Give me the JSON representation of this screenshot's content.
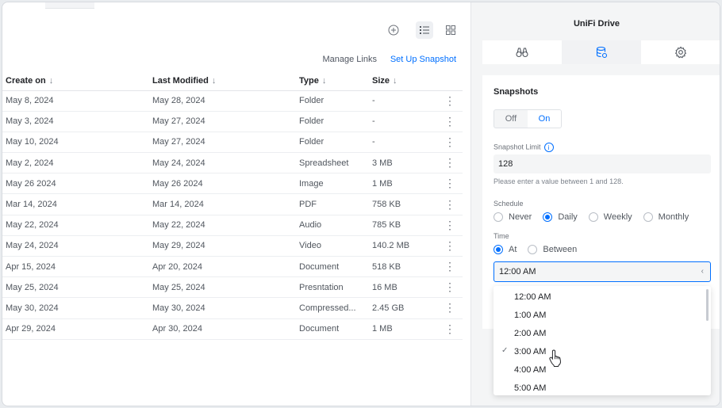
{
  "toolbar": {
    "icons": [
      "add-circle-icon",
      "list-view-icon",
      "grid-view-icon"
    ],
    "manage_links": "Manage Links",
    "setup_snapshot": "Set Up Snapshot"
  },
  "table": {
    "headers": {
      "created": "Create on",
      "modified": "Last Modified",
      "type": "Type",
      "size": "Size"
    },
    "sort_glyph": "↓",
    "rows": [
      {
        "created": "May 8, 2024",
        "modified": "May 28, 2024",
        "type": "Folder",
        "size": "-"
      },
      {
        "created": "May 3, 2024",
        "modified": "May 27, 2024",
        "type": "Folder",
        "size": "-"
      },
      {
        "created": "May 10, 2024",
        "modified": "May 27, 2024",
        "type": "Folder",
        "size": "-"
      },
      {
        "created": "May 2, 2024",
        "modified": "May 24, 2024",
        "type": "Spreadsheet",
        "size": "3 MB"
      },
      {
        "created": "May 26 2024",
        "modified": "May 26 2024",
        "type": "Image",
        "size": "1 MB"
      },
      {
        "created": "Mar 14, 2024",
        "modified": "Mar 14, 2024",
        "type": "PDF",
        "size": "758 KB"
      },
      {
        "created": "May 22, 2024",
        "modified": "May 22, 2024",
        "type": "Audio",
        "size": "785 KB"
      },
      {
        "created": "May 24, 2024",
        "modified": "May 29, 2024",
        "type": "Video",
        "size": "140.2 MB"
      },
      {
        "created": "Apr 15, 2024",
        "modified": "Apr 20, 2024",
        "type": "Document",
        "size": "518 KB"
      },
      {
        "created": "May 25, 2024",
        "modified": "May 25, 2024",
        "type": "Presntation",
        "size": "16 MB"
      },
      {
        "created": "May 30, 2024",
        "modified": "May 30, 2024",
        "type": "Compressed...",
        "size": "2.45 GB"
      },
      {
        "created": "Apr 29, 2024",
        "modified": "Apr 30, 2024",
        "type": "Document",
        "size": "1 MB"
      }
    ]
  },
  "panel": {
    "title": "UniFi Drive",
    "tabs": [
      "binoculars-icon",
      "storage-icon",
      "gear-icon"
    ],
    "active_tab": 1,
    "snapshots_title": "Snapshots",
    "toggle": {
      "off": "Off",
      "on": "On",
      "selected": "On"
    },
    "limit_label": "Snapshot Limit",
    "limit_value": "128",
    "limit_hint": "Please enter a value between 1 and 128.",
    "schedule_label": "Schedule",
    "schedule_options": [
      "Never",
      "Daily",
      "Weekly",
      "Monthly"
    ],
    "schedule_selected": "Daily",
    "time_label": "Time",
    "time_options": [
      "At",
      "Between"
    ],
    "time_selected": "At",
    "time_value": "12:00 AM",
    "dropdown_options": [
      "12:00 AM",
      "1:00 AM",
      "2:00 AM",
      "3:00 AM",
      "4:00 AM",
      "5:00 AM"
    ],
    "checked_option": "3:00 AM"
  },
  "colors": {
    "accent": "#006fff",
    "text": "#212327",
    "muted": "#50565e"
  }
}
